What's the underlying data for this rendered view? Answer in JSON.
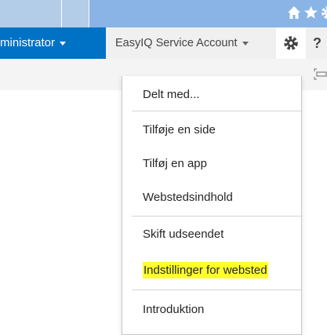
{
  "topbar": {
    "icons": [
      "home-icon",
      "star-icon",
      "settings-icon"
    ]
  },
  "suitebar": {
    "user_label": "ministrator",
    "account_label": "EasyIQ Service Account",
    "help_label": "?"
  },
  "menu": {
    "items": [
      {
        "label": "Delt med..."
      },
      {
        "label": "Tilføje en side"
      },
      {
        "label": "Tilføj en app"
      },
      {
        "label": "Webstedsindhold"
      },
      {
        "label": "Skift udseendet"
      },
      {
        "label": "Indstillinger for websted",
        "highlighted": true
      },
      {
        "label": "Introduktion"
      }
    ],
    "highlight_color": "#ffff2e"
  },
  "colors": {
    "topbar": "#8ab4e6",
    "accent": "#0072c6"
  }
}
